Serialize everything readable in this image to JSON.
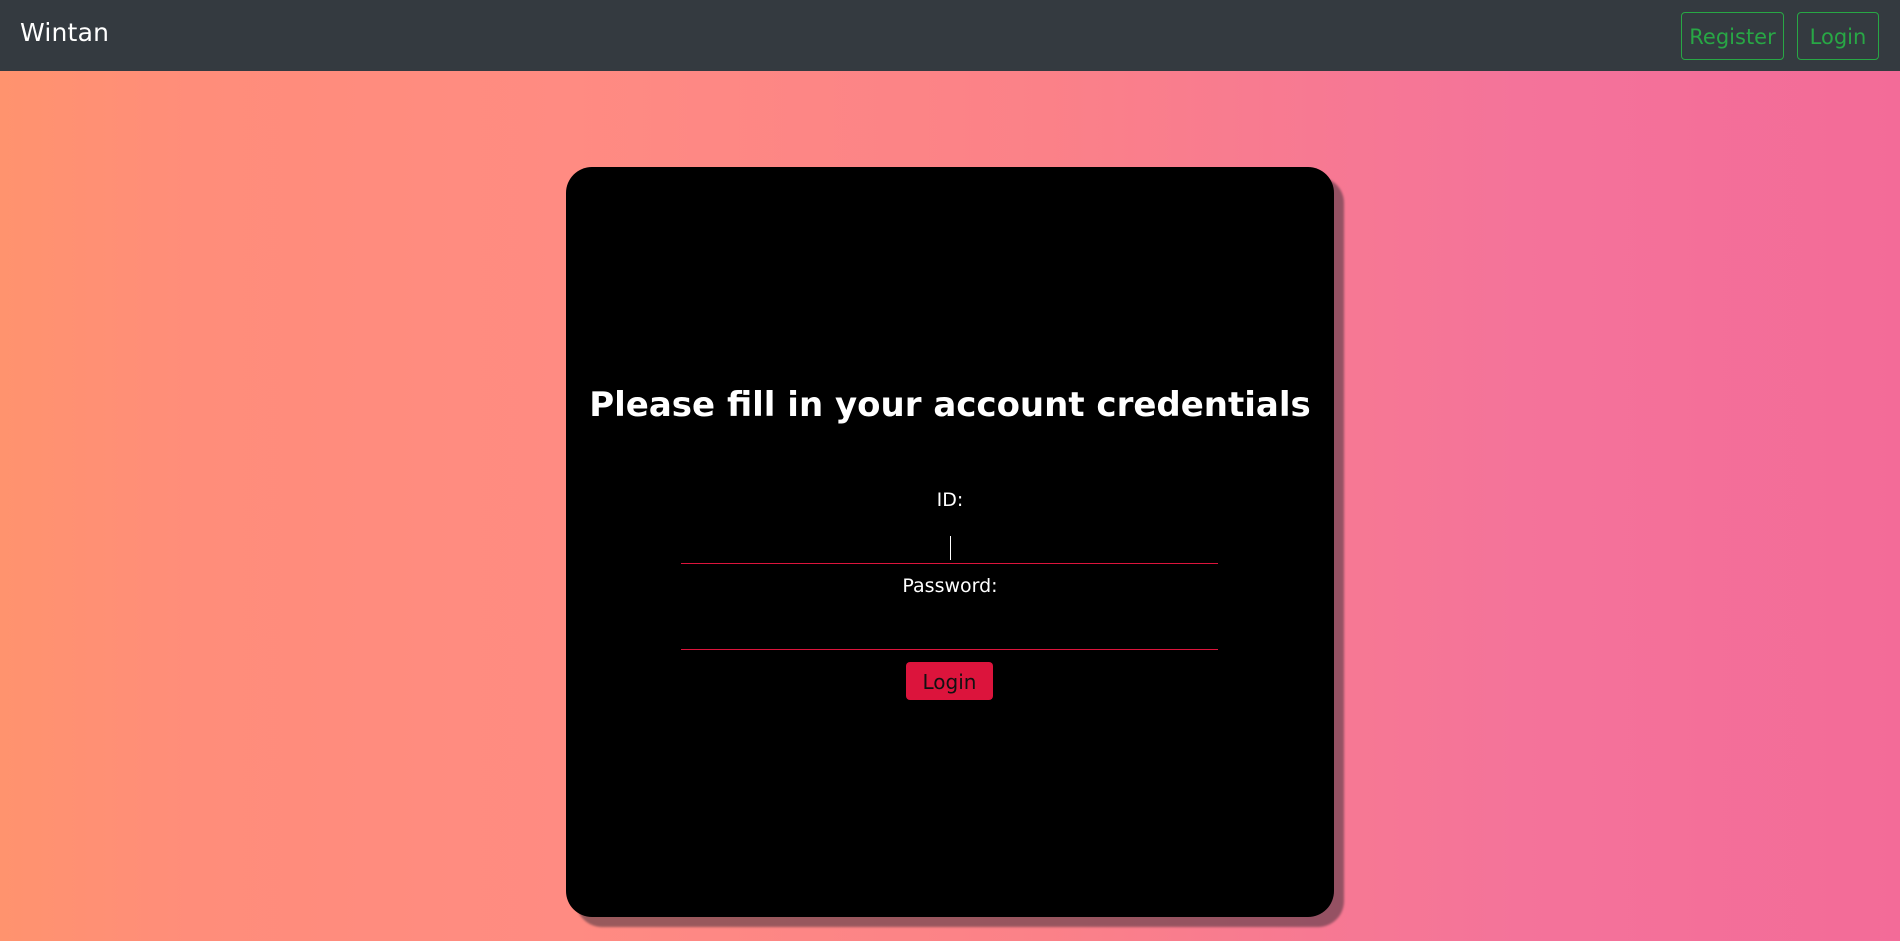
{
  "navbar": {
    "brand": "Wintan",
    "register_label": "Register",
    "login_label": "Login"
  },
  "form": {
    "title": "Please fill in your account credentials",
    "id_label": "ID:",
    "id_value": "",
    "password_label": "Password:",
    "password_value": "",
    "submit_label": "Login"
  },
  "colors": {
    "navbar_bg": "#343a40",
    "nav_button_accent": "#28a745",
    "card_bg": "#000000",
    "input_underline": "#dc143c",
    "submit_bg": "#dc143c",
    "gradient_left": "#ff936e",
    "gradient_right": "#f36b98"
  }
}
